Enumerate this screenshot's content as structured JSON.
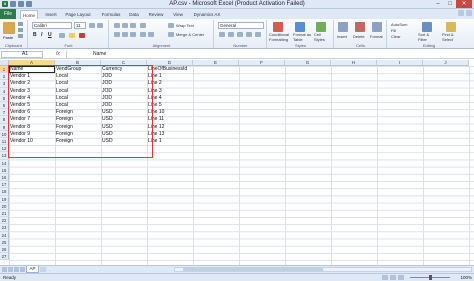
{
  "window": {
    "title": "AP.csv - Microsoft Excel (Product Activation Failed)"
  },
  "ribbon_tabs": [
    "File",
    "Home",
    "Insert",
    "Page Layout",
    "Formulas",
    "Data",
    "Review",
    "View",
    "Dynamics AX"
  ],
  "ribbon": {
    "clipboard": {
      "paste": "Paste",
      "label": "Clipboard"
    },
    "font": {
      "name": "Calibri",
      "size": "11",
      "bold": "B",
      "italic": "I",
      "underline": "U",
      "label": "Font"
    },
    "alignment": {
      "wrap_text": "Wrap Text",
      "merge_center": "Merge & Center",
      "label": "Alignment"
    },
    "number": {
      "format": "General",
      "label": "Number"
    },
    "styles": {
      "conditional": "Conditional Formatting",
      "format_table": "Format as Table",
      "cell_styles": "Cell Styles",
      "label": "Styles"
    },
    "cells": {
      "insert": "Insert",
      "delete": "Delete",
      "format": "Format",
      "label": "Cells"
    },
    "editing": {
      "autosum": "AutoSum",
      "fill": "Fill",
      "clear": "Clear",
      "sort_filter": "Sort & Filter",
      "find_select": "Find & Select",
      "label": "Editing"
    }
  },
  "formula_bar": {
    "name_box": "A1",
    "fx": "fx",
    "value": "Name"
  },
  "columns": [
    "A",
    "B",
    "C",
    "D",
    "E",
    "F",
    "G",
    "H",
    "I",
    "J"
  ],
  "rows": [
    "1",
    "2",
    "3",
    "4",
    "5",
    "6",
    "7",
    "8",
    "9",
    "10",
    "11",
    "12",
    "13",
    "14",
    "15",
    "16",
    "17",
    "18",
    "19",
    "20",
    "21",
    "22",
    "23",
    "24",
    "25",
    "26",
    "27"
  ],
  "table": {
    "headers": [
      "Name",
      "VendGroup",
      "Currency",
      "LineOfBusinessId"
    ],
    "rows": [
      [
        "Vendor 1",
        "Local",
        "JOD",
        "Line 1"
      ],
      [
        "Vendor 2",
        "Local",
        "JOD",
        "Line 2"
      ],
      [
        "Vendor 3",
        "Local",
        "JOD",
        "Line 3"
      ],
      [
        "Vendor 4",
        "Local",
        "JOD",
        "Line 4"
      ],
      [
        "Vendor 5",
        "Local",
        "JOD",
        "Line 5"
      ],
      [
        "Vendor 6",
        "Foreign",
        "USD",
        "Line 10"
      ],
      [
        "Vendor 7",
        "Foreign",
        "USD",
        "Line 11"
      ],
      [
        "Vendor 8",
        "Foreign",
        "USD",
        "Line 12"
      ],
      [
        "Vendor 9",
        "Foreign",
        "USD",
        "Line 13"
      ],
      [
        "Vendor 10",
        "Foreign",
        "USD",
        "Line 1"
      ]
    ]
  },
  "sheet_tabs": [
    "AP"
  ],
  "status": {
    "ready": "Ready",
    "zoom": "100%"
  },
  "colors": {
    "accent": "#1f7a3e",
    "highlight_box": "#e0343a"
  }
}
